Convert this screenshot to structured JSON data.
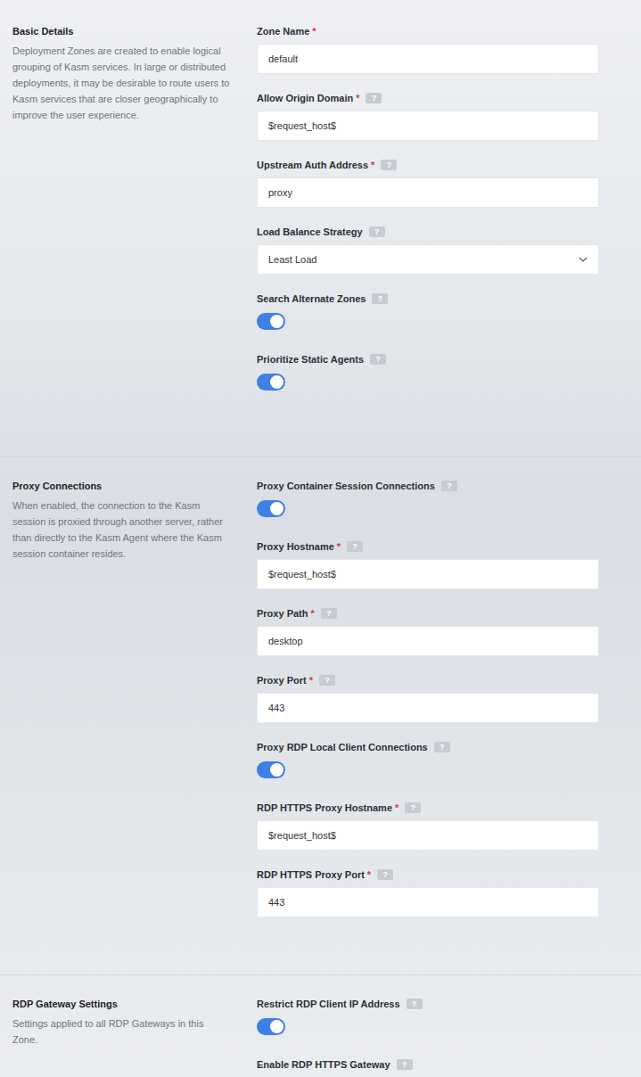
{
  "sections": [
    {
      "title": "Basic Details",
      "description": "Deployment Zones are created to enable logical grouping of Kasm services. In large or distributed deployments, it may be desirable to route users to Kasm services that are closer geographically to improve the user experience.",
      "fields": [
        {
          "kind": "text",
          "label": "Zone Name",
          "required_mark": "*",
          "value": "default"
        },
        {
          "kind": "text",
          "label": "Allow Origin Domain",
          "required_mark": "*",
          "help": "?",
          "value": "$request_host$"
        },
        {
          "kind": "text",
          "label": "Upstream Auth Address",
          "required_mark": "*",
          "help": "?",
          "value": "proxy"
        },
        {
          "kind": "select",
          "label": "Load Balance Strategy",
          "help": "?",
          "value": "Least Load"
        },
        {
          "kind": "toggle",
          "label": "Search Alternate Zones",
          "help": "?",
          "on": true
        },
        {
          "kind": "toggle",
          "label": "Prioritize Static Agents",
          "help": "?",
          "on": true
        }
      ]
    },
    {
      "title": "Proxy Connections",
      "description": "When enabled, the connection to the Kasm session is proxied through another server, rather than directly to the Kasm Agent where the Kasm session container resides.",
      "fields": [
        {
          "kind": "toggle",
          "label": "Proxy Container Session Connections",
          "help": "?",
          "on": true
        },
        {
          "kind": "text",
          "label": "Proxy Hostname",
          "required_mark": "*",
          "help": "?",
          "value": "$request_host$"
        },
        {
          "kind": "text",
          "label": "Proxy Path",
          "required_mark": "*",
          "help": "?",
          "value": "desktop"
        },
        {
          "kind": "text",
          "label": "Proxy Port",
          "required_mark": "*",
          "help": "?",
          "value": "443"
        },
        {
          "kind": "toggle",
          "label": "Proxy RDP Local Client Connections",
          "help": "?",
          "on": true
        },
        {
          "kind": "text",
          "label": "RDP HTTPS Proxy Hostname",
          "required_mark": "*",
          "help": "?",
          "value": "$request_host$"
        },
        {
          "kind": "text",
          "label": "RDP HTTPS Proxy Port",
          "required_mark": "*",
          "help": "?",
          "value": "443"
        }
      ]
    },
    {
      "title": "RDP Gateway Settings",
      "description": "Settings applied to all RDP Gateways in this Zone.",
      "fields": [
        {
          "kind": "toggle",
          "label": "Restrict RDP Client IP Address",
          "help": "?",
          "on": true
        },
        {
          "kind": "toggle",
          "label": "Enable RDP HTTPS Gateway",
          "help": "?",
          "on": true
        }
      ]
    }
  ]
}
